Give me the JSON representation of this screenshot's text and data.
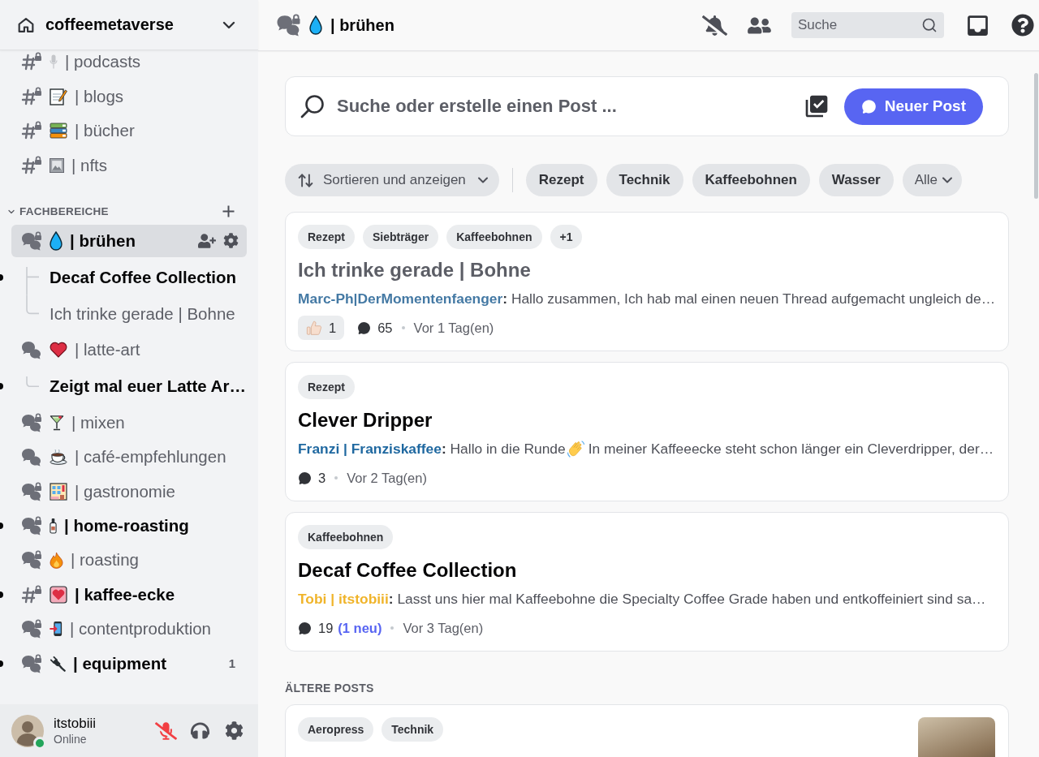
{
  "server": {
    "name": "coffeemetaverse"
  },
  "sidebar": {
    "channels": [
      {
        "kind": "text",
        "locked": true,
        "name": "| podcasts",
        "unread": false,
        "selected": false
      },
      {
        "kind": "text",
        "locked": true,
        "name": "| blogs",
        "unread": false,
        "selected": false
      },
      {
        "kind": "text",
        "locked": true,
        "name": "| bücher",
        "unread": false,
        "selected": false
      },
      {
        "kind": "text",
        "locked": true,
        "name": "| nfts",
        "unread": false,
        "selected": false
      }
    ],
    "categories": [
      {
        "name": "FACHBEREICHE",
        "expanded": true,
        "channels": [
          {
            "kind": "forum",
            "locked": true,
            "name": "| brühen",
            "unread": false,
            "selected": true,
            "children": [
              {
                "name": "Decaf Coffee Collection",
                "unread": true,
                "selected": false
              },
              {
                "name": "Ich trinke gerade | Bohne",
                "unread": false,
                "selected": false
              }
            ]
          },
          {
            "kind": "forum",
            "locked": false,
            "name": "| latte-art",
            "unread": false,
            "selected": false,
            "children": [
              {
                "name": "Zeigt mal euer Latte Ar…",
                "unread": true,
                "selected": false
              }
            ]
          },
          {
            "kind": "forum",
            "locked": true,
            "name": "| mixen",
            "unread": false,
            "selected": false
          },
          {
            "kind": "forum",
            "locked": false,
            "name": "| café-empfehlungen",
            "unread": false,
            "selected": false
          },
          {
            "kind": "forum",
            "locked": true,
            "name": "| gastronomie",
            "unread": false,
            "selected": false
          },
          {
            "kind": "forum",
            "locked": true,
            "name": "| home-roasting",
            "unread": true,
            "selected": false
          },
          {
            "kind": "forum",
            "locked": true,
            "name": "| roasting",
            "unread": false,
            "selected": false
          },
          {
            "kind": "text",
            "locked": true,
            "name": "| kaffee-ecke",
            "unread": true,
            "selected": false
          },
          {
            "kind": "forum",
            "locked": true,
            "name": "| contentproduktion",
            "unread": false,
            "selected": false
          },
          {
            "kind": "forum",
            "locked": true,
            "name": "| equipment",
            "unread": true,
            "selected": false,
            "count": "1"
          }
        ]
      }
    ]
  },
  "user_panel": {
    "name": "itstobiii",
    "status": "Online",
    "online": true,
    "muted": true
  },
  "channel_header": {
    "kind": "forum",
    "locked": true,
    "name": "| brühen",
    "search": {
      "placeholder": "Suche"
    }
  },
  "forum": {
    "search": {
      "placeholder": "Suche oder erstelle einen Post ..."
    },
    "new_post_button": "Neuer Post",
    "sort_button": "Sortieren und anzeigen",
    "tag_filters": [
      {
        "kind": "tag",
        "label": "Rezept"
      },
      {
        "kind": "tag",
        "label": "Technik"
      },
      {
        "kind": "tag",
        "label": "Kaffeebohnen"
      },
      {
        "kind": "tag",
        "label": "Wasser"
      },
      {
        "kind": "dropdown",
        "label": "Alle"
      }
    ],
    "posts": [
      {
        "tags": [
          {
            "label": "Rezept"
          },
          {
            "label": "Siebträger"
          },
          {
            "label": "Kaffeebohnen"
          },
          {
            "label": "+1"
          }
        ],
        "title": "Ich trinke gerade | Bohne",
        "unread": false,
        "author": {
          "name": "Marc-Ph|DerMomentenfaenger",
          "color": "#4479a4"
        },
        "preview": [
          {
            "kind": "text",
            "text": "**:** Hallo zusammen, Ich hab mal einen neuen Thread aufgemacht ungleich de…"
          }
        ],
        "reactions": [
          {
            "count": "1"
          }
        ],
        "comments": "65",
        "time": "Vor 1 Tag(en)"
      },
      {
        "tags": [
          {
            "label": "Rezept"
          }
        ],
        "title": "Clever Dripper",
        "unread": true,
        "author": {
          "name": "Franzi | Franziskaffee",
          "color": "#1f68a0"
        },
        "preview": [
          {
            "kind": "text",
            "text": "**:** Hallo in die Runde"
          },
          {
            "kind": "emoji"
          },
          {
            "kind": "text",
            "text": "In meiner Kaffeeecke steht schon länger ein Cleverdripper, der…"
          }
        ],
        "comments": "3",
        "time": "Vor 2 Tag(en)"
      },
      {
        "tags": [
          {
            "label": "Kaffeebohnen"
          }
        ],
        "title": "Decaf Coffee Collection",
        "unread": true,
        "author": {
          "name": "Tobi | itstobiii",
          "color": "#f0b42a"
        },
        "preview": [
          {
            "kind": "text",
            "text": "**:** Lasst uns hier mal Kaffeebohne die Specialty Coffee Grade haben und entkoffeiniert sind sa…"
          }
        ],
        "comments": "19",
        "new_comments": "(1 neu)",
        "time": "Vor 3 Tag(en)"
      }
    ],
    "older_label": "ÄLTERE POSTS",
    "older_posts": [
      {
        "tags": [
          {
            "label": "Aeropress"
          },
          {
            "label": "Technik"
          }
        ],
        "thumbnail": true
      }
    ]
  }
}
